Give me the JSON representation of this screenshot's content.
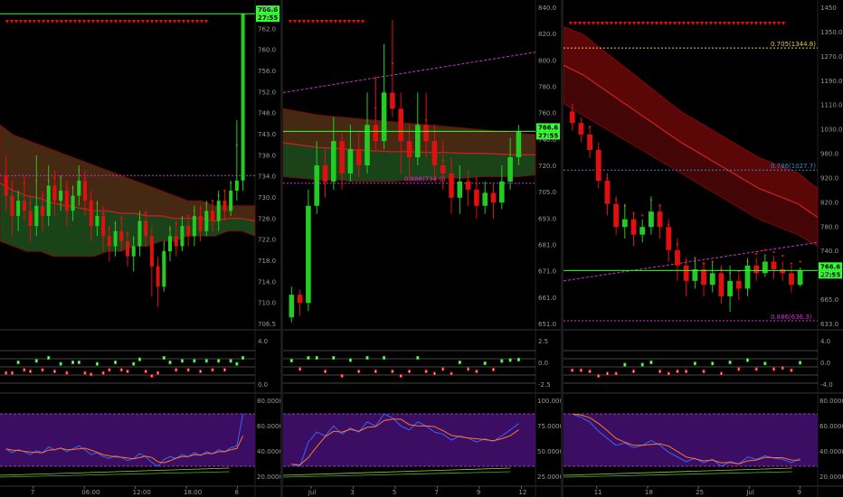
{
  "colors": {
    "background": "#000000",
    "bull": "#22cc22",
    "bear": "#e01010",
    "cloud_bull": "#2f7a2f",
    "cloud_bear": "#7a0a0a",
    "price_line": "#33ff33",
    "magenta": "#cc33cc",
    "stoch_bg": "#3b0d63",
    "stoch_k": "#3366ff",
    "stoch_d": "#ff7722",
    "fib_yellow": "#e0d040",
    "fib_blue": "#3388cc"
  },
  "chart_data": [
    {
      "type": "candlestick",
      "panel": "left",
      "y_ticks": [
        "766.0",
        "762.0",
        "760.0",
        "756.0",
        "752.0",
        "748.0",
        "743.0",
        "738.0",
        "734.0",
        "730.0",
        "726.0",
        "722.0",
        "718.0",
        "714.0",
        "710.0",
        "706.5"
      ],
      "ylim": [
        704,
        768
      ],
      "x_ticks": [
        "7",
        "06:00",
        "12:00",
        "18:00",
        "8"
      ],
      "price_badge": "766.6",
      "time_badge": "27:55",
      "osc_ticks": [
        "4.0",
        "0.0"
      ],
      "stoch_ticks": [
        "80.0000",
        "60.0000",
        "40.0000",
        "20.0000"
      ],
      "candles": [
        [
          734,
          730,
          738,
          727
        ],
        [
          730,
          726,
          733,
          722
        ],
        [
          726,
          729,
          731,
          723
        ],
        [
          729,
          727,
          734,
          725
        ],
        [
          727,
          724,
          730,
          721
        ],
        [
          724,
          728,
          738,
          722
        ],
        [
          728,
          726,
          731,
          723
        ],
        [
          726,
          732,
          736,
          724
        ],
        [
          732,
          729,
          735,
          726
        ],
        [
          729,
          731,
          734,
          727
        ],
        [
          731,
          727,
          733,
          724
        ],
        [
          727,
          730,
          732,
          725
        ],
        [
          730,
          733,
          736,
          728
        ],
        [
          733,
          729,
          735,
          726
        ],
        [
          729,
          724,
          731,
          721
        ],
        [
          724,
          726,
          729,
          722
        ],
        [
          726,
          722,
          728,
          719
        ],
        [
          722,
          720,
          724,
          717
        ],
        [
          720,
          723,
          725,
          718
        ],
        [
          723,
          721,
          726,
          719
        ],
        [
          721,
          718,
          723,
          716
        ],
        [
          718,
          720,
          722,
          715
        ],
        [
          720,
          725,
          727,
          718
        ],
        [
          725,
          722,
          727,
          720
        ],
        [
          722,
          716,
          724,
          710
        ],
        [
          716,
          712,
          718,
          708
        ],
        [
          712,
          719,
          721,
          711
        ],
        [
          719,
          722,
          724,
          717
        ],
        [
          722,
          720,
          725,
          718
        ],
        [
          720,
          724,
          726,
          719
        ],
        [
          724,
          722,
          726,
          720
        ],
        [
          722,
          726,
          728,
          720
        ],
        [
          726,
          723,
          728,
          721
        ],
        [
          723,
          727,
          729,
          722
        ],
        [
          727,
          725,
          729,
          723
        ],
        [
          725,
          729,
          731,
          723
        ],
        [
          729,
          727,
          731,
          725
        ],
        [
          727,
          731,
          733,
          726
        ],
        [
          731,
          733,
          745,
          729
        ],
        [
          733,
          766,
          766,
          731
        ]
      ],
      "cloud_top": [
        744,
        742,
        741,
        740,
        739,
        738,
        737,
        736,
        735,
        734,
        733,
        732,
        731,
        730,
        729,
        729,
        728,
        728,
        728,
        728
      ],
      "cloud_bottom": [
        721,
        720,
        719,
        719,
        718,
        718,
        718,
        718,
        719,
        719,
        720,
        720,
        721,
        721,
        722,
        722,
        722,
        723,
        723,
        722
      ],
      "magenta_level": 734
    },
    {
      "type": "candlestick",
      "panel": "middle",
      "y_ticks": [
        "840.0",
        "820.0",
        "800.0",
        "780.0",
        "760.0",
        "740.0",
        "720.0",
        "705.0",
        "693.0",
        "681.0",
        "671.0",
        "661.0",
        "651.0"
      ],
      "ylim": [
        645,
        845
      ],
      "x_ticks": [
        "Jul",
        "3",
        "5",
        "7",
        "9",
        "12"
      ],
      "price_badge": "766.6",
      "time_badge": "27:55",
      "fib_label": "0.886(734.0)",
      "osc_ticks": [
        "2.5",
        "0.0",
        "-2.5"
      ],
      "stoch_ticks": [
        "100.0000",
        "75.0000",
        "50.0000",
        "25.0000"
      ],
      "candles": [
        [
          651,
          665,
          670,
          648
        ],
        [
          665,
          660,
          668,
          652
        ],
        [
          660,
          720,
          730,
          655
        ],
        [
          720,
          745,
          760,
          715
        ],
        [
          745,
          735,
          755,
          725
        ],
        [
          735,
          760,
          775,
          730
        ],
        [
          760,
          740,
          765,
          730
        ],
        [
          740,
          755,
          770,
          735
        ],
        [
          755,
          745,
          765,
          738
        ],
        [
          745,
          770,
          790,
          740
        ],
        [
          770,
          760,
          800,
          755
        ],
        [
          760,
          790,
          820,
          755
        ],
        [
          790,
          780,
          835,
          775
        ],
        [
          780,
          760,
          790,
          740
        ],
        [
          760,
          750,
          770,
          735
        ],
        [
          750,
          770,
          790,
          745
        ],
        [
          770,
          760,
          790,
          750
        ],
        [
          760,
          745,
          770,
          735
        ],
        [
          745,
          740,
          760,
          730
        ],
        [
          740,
          725,
          750,
          715
        ],
        [
          725,
          735,
          745,
          715
        ],
        [
          735,
          730,
          742,
          720
        ],
        [
          730,
          720,
          738,
          712
        ],
        [
          720,
          728,
          735,
          715
        ],
        [
          728,
          722,
          734,
          712
        ],
        [
          722,
          735,
          745,
          718
        ],
        [
          735,
          750,
          762,
          730
        ],
        [
          750,
          766,
          770,
          745
        ]
      ],
      "cloud_top": [
        780,
        778,
        776,
        775,
        774,
        773,
        772,
        771,
        770,
        769,
        768,
        767,
        766,
        765,
        764
      ],
      "cloud_bottom": [
        738,
        737,
        736,
        736,
        735,
        735,
        735,
        736,
        736,
        737,
        737,
        738,
        738,
        738,
        739
      ],
      "magenta_line": [
        790,
        815
      ],
      "magenta_level": 734
    },
    {
      "type": "candlestick",
      "panel": "right",
      "y_ticks": [
        "1450",
        "1350.0",
        "1270.0",
        "1190.0",
        "1110.0",
        "1030.0",
        "980.0",
        "920.0",
        "820.0",
        "780.0",
        "740.0",
        "700.0",
        "665.0",
        "633.0"
      ],
      "ylim": [
        620,
        1460
      ],
      "x_ticks": [
        "11",
        "18",
        "25",
        "Jul",
        "9"
      ],
      "price_badge": "766.6",
      "time_badge": "27:55",
      "fib_labels": [
        "0.705(1344.8)",
        "0.786(1027.7)",
        "0.886(636.3)"
      ],
      "fib_levels": [
        1344.8,
        1027.7,
        636.3
      ],
      "osc_ticks": [
        "4.0",
        "0.0",
        "-4.0"
      ],
      "stoch_ticks": [
        "80.0000",
        "60.0000",
        "40.0000",
        "20.0000"
      ],
      "candles": [
        [
          1180,
          1150,
          1200,
          1130
        ],
        [
          1150,
          1120,
          1165,
          1100
        ],
        [
          1120,
          1080,
          1140,
          1060
        ],
        [
          1080,
          1000,
          1100,
          980
        ],
        [
          1000,
          940,
          1020,
          910
        ],
        [
          940,
          880,
          960,
          860
        ],
        [
          880,
          900,
          940,
          850
        ],
        [
          900,
          860,
          920,
          830
        ],
        [
          860,
          880,
          900,
          840
        ],
        [
          880,
          920,
          960,
          860
        ],
        [
          920,
          880,
          940,
          850
        ],
        [
          880,
          820,
          900,
          790
        ],
        [
          820,
          780,
          850,
          740
        ],
        [
          780,
          740,
          800,
          700
        ],
        [
          740,
          770,
          800,
          720
        ],
        [
          770,
          730,
          790,
          700
        ],
        [
          730,
          760,
          790,
          710
        ],
        [
          760,
          700,
          780,
          680
        ],
        [
          700,
          740,
          780,
          660
        ],
        [
          740,
          720,
          760,
          690
        ],
        [
          720,
          780,
          800,
          700
        ],
        [
          780,
          760,
          800,
          740
        ],
        [
          760,
          790,
          810,
          750
        ],
        [
          790,
          770,
          805,
          745
        ],
        [
          770,
          760,
          790,
          740
        ],
        [
          760,
          730,
          780,
          710
        ],
        [
          730,
          767,
          775,
          725
        ]
      ],
      "cloud_top": [
        1400,
        1380,
        1340,
        1300,
        1260,
        1220,
        1180,
        1150,
        1120,
        1090,
        1060,
        1040,
        1020,
        980
      ],
      "cloud_bottom": [
        1200,
        1170,
        1140,
        1110,
        1080,
        1050,
        1020,
        990,
        960,
        930,
        900,
        880,
        860,
        830
      ],
      "magenta_line": [
        740,
        840
      ]
    }
  ]
}
